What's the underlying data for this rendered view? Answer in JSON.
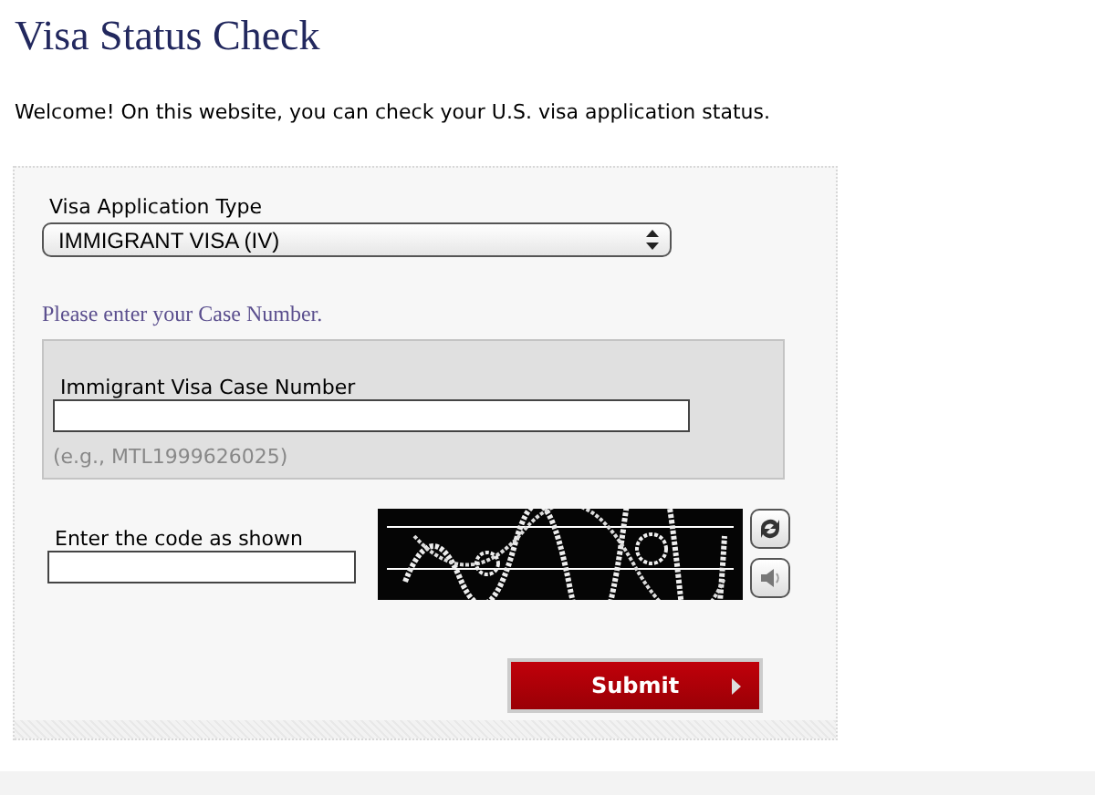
{
  "page": {
    "title": "Visa Status Check",
    "intro": "Welcome! On this website, you can check your U.S. visa application status."
  },
  "form": {
    "type_label": "Visa Application Type",
    "type_value": "IMMIGRANT VISA (IV)",
    "case_prompt": "Please enter your Case Number.",
    "case_label": "Immigrant Visa Case Number",
    "case_hint": "(e.g., MTL1999626025)",
    "code_label": "Enter the code as shown",
    "submit": "Submit"
  }
}
